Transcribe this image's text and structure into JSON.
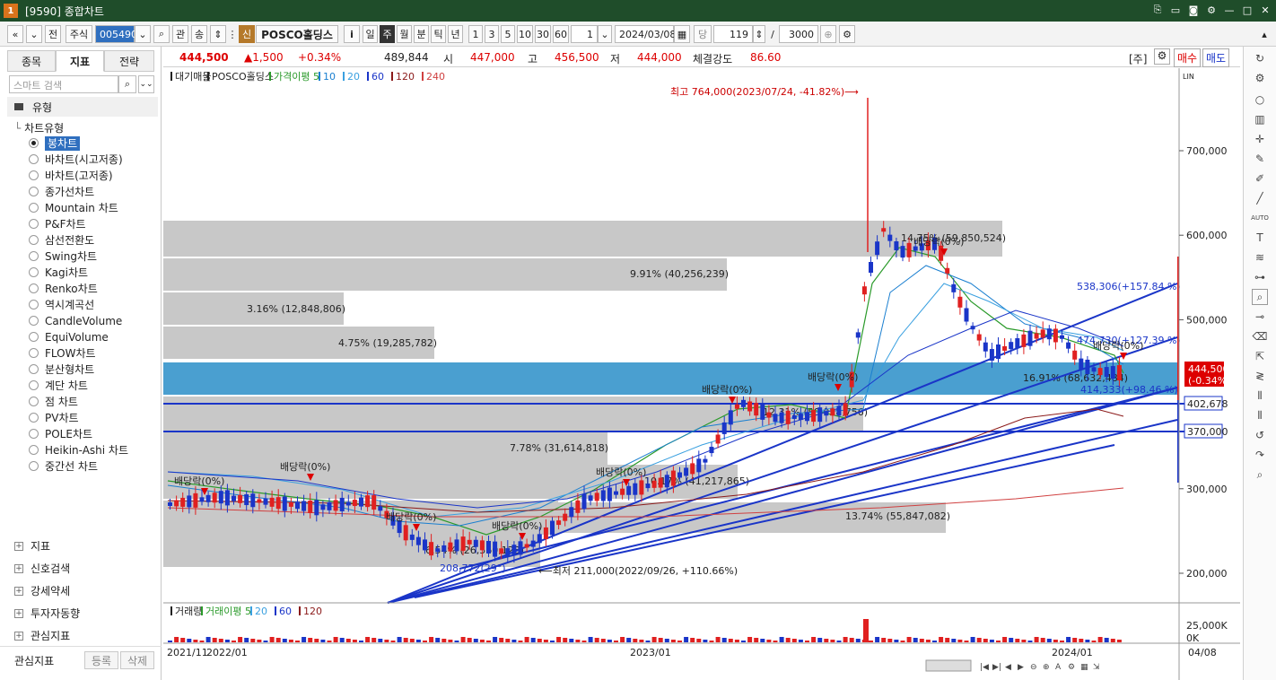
{
  "window": {
    "title": "[9590] 종합차트",
    "app_badge": "1"
  },
  "toolbar": {
    "nav_first": "«",
    "nav_prev": "»",
    "prev_label": "전",
    "market": "주식",
    "code": "005490",
    "tool_a": "관",
    "tool_b": "송",
    "badge": "신",
    "stock_name": "POSCO홀딩스",
    "info": "i",
    "periods": [
      "일",
      "주",
      "월",
      "분",
      "틱",
      "년"
    ],
    "selected_period": "주",
    "intervals": [
      "1",
      "3",
      "5",
      "10",
      "30",
      "60"
    ],
    "interval_value": "1",
    "date": "2024/03/08",
    "count_label": "당",
    "count_value": "119",
    "slash": "/",
    "total": "3000"
  },
  "left_panel": {
    "tabs": [
      "종목",
      "지표",
      "전략"
    ],
    "active_tab": "지표",
    "search_placeholder": "스마트 검색",
    "section_title": "유형",
    "tree_root": "차트유형",
    "chart_types": [
      "봉차트",
      "바차트(시고저종)",
      "바차트(고저종)",
      "종가선차트",
      "Mountain 차트",
      "P&F차트",
      "삼선전환도",
      "Swing차트",
      "Kagi차트",
      "Renko차트",
      "역시계곡선",
      "CandleVolume",
      "EquiVolume",
      "FLOW차트",
      "분산형차트",
      "계단 차트",
      "점 차트",
      "PV차트",
      "POLE차트",
      "Heikin-Ashi 차트",
      "중간선 차트"
    ],
    "selected_type": "봉차트",
    "groups": [
      "지표",
      "신호검색",
      "강세약세",
      "투자자동향",
      "관심지표"
    ],
    "footer_label": "관심지표",
    "footer_buttons": [
      "등록",
      "삭제"
    ]
  },
  "quote": {
    "price": "444,500",
    "change": "▲1,500",
    "rate": "+0.34%",
    "volume": "489,844",
    "open_label": "시",
    "open": "447,000",
    "high_label": "고",
    "high": "456,500",
    "low_label": "저",
    "low": "444,000",
    "strength_label": "체결강도",
    "strength": "86.60",
    "unit_label": "[주]",
    "buy": "매수",
    "sell": "매도"
  },
  "legend": {
    "items": [
      "대기매물",
      "POSCO홀딩스",
      "가격이평 5",
      "10",
      "20",
      "60",
      "120",
      "240"
    ]
  },
  "volume_legend": {
    "items": [
      "거래량",
      "거래이평 5",
      "20",
      "60",
      "120"
    ]
  },
  "colors": {
    "up": "#e02020",
    "down": "#1a35c8",
    "ma5": "#2a9a2a",
    "ma10": "#1a7fd0",
    "ma20": "#3aa0e0",
    "ma60": "#1a35c8",
    "ma120": "#8b1a1a",
    "ma240": "#d04040",
    "profile": "#c8c8c8",
    "profile_hi": "#4a9fd0"
  },
  "chart_data": {
    "type": "candlestick",
    "y_ticks": [
      "700,000",
      "600,000",
      "500,000",
      "300,000",
      "200,000"
    ],
    "y_tick_values": [
      700000,
      600000,
      500000,
      300000,
      200000
    ],
    "x_labels": [
      "2021/11",
      "2022/01",
      "2023/01",
      "2024/01"
    ],
    "x_label_end": "04/08",
    "vol_ticks": [
      "25,000K",
      "0K"
    ],
    "price_tag": "444,500",
    "price_tag_rate": "(-0.34%)",
    "line_tags": [
      "402,678",
      "370,000"
    ],
    "profile_labels": [
      "14.75% (59,850,524)",
      "9.91% (40,256,239)",
      "3.16% (12,848,806)",
      "4.75% (19,285,782)",
      "16.91% (68,632,484)",
      "12.31% (50,028,756)",
      "7.78% (31,614,818)",
      "10.17% (41,217,865)",
      "6.54% (26,560,123)",
      "13.74% (55,847,082)"
    ],
    "annotations": {
      "high": "최고 764,000(2023/07/24, -41.82%)",
      "low": "최저 211,000(2022/09/26, +110.66%)",
      "trend1": "538,306(+157.84 %)",
      "trend2": "474,730(+127.39 %)",
      "trend3": "414,333(+98.46 %)",
      "trend_start": "208,772(29°)",
      "dividend": "배당락(0%)"
    }
  }
}
